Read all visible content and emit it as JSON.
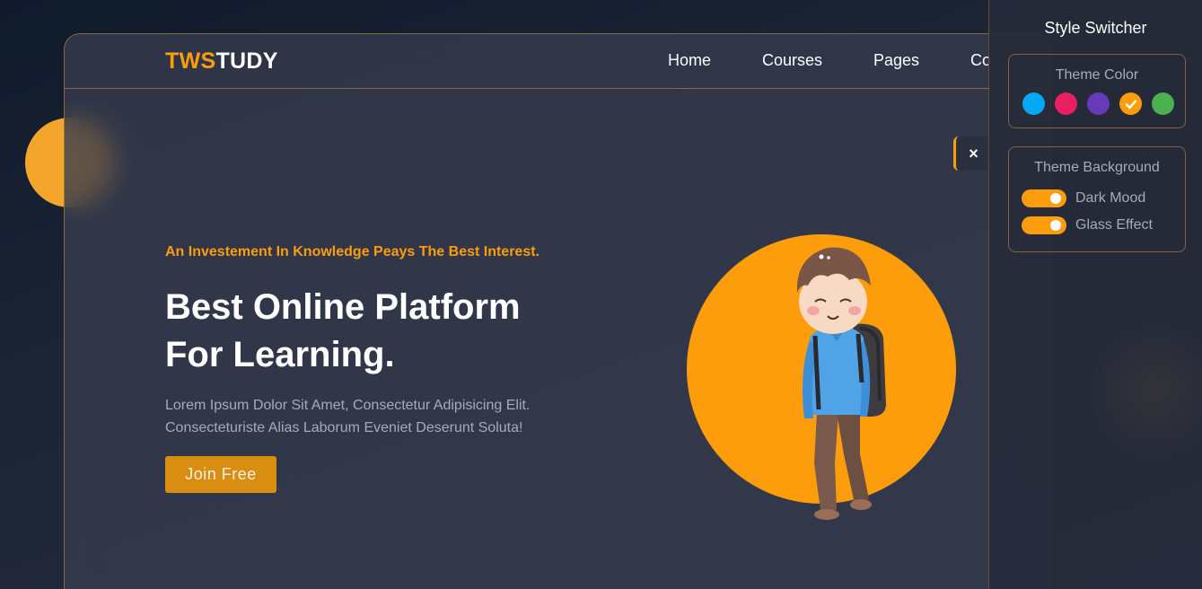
{
  "brand": {
    "part1": "TWS",
    "part2": "TUDY"
  },
  "nav": {
    "items": [
      "Home",
      "Courses",
      "Pages",
      "Co"
    ]
  },
  "hero": {
    "tagline": "An Investement In Knowledge Peays The Best Interest.",
    "heading_line1": "Best Online Platform",
    "heading_line2": "For Learning.",
    "desc_line1": "Lorem Ipsum Dolor Sit Amet, Consectetur Adipisicing Elit.",
    "desc_line2": "Consecteturiste Alias Laborum Eveniet Deserunt Soluta!",
    "cta": "Join Free"
  },
  "close_button": {
    "icon": "close-icon",
    "label": "×"
  },
  "style_switcher": {
    "title": "Style Switcher",
    "theme_color": {
      "title": "Theme Color",
      "colors": [
        "#03a9f4",
        "#e91e63",
        "#673ab7",
        "#fd9d0c",
        "#4caf50"
      ],
      "selected_index": 3,
      "selected_icon": "check-icon"
    },
    "theme_background": {
      "title": "Theme Background",
      "toggles": [
        {
          "label": "Dark Mood",
          "on": true
        },
        {
          "label": "Glass Effect",
          "on": true
        }
      ]
    }
  },
  "colors": {
    "accent": "#fd9d0c",
    "text": "#ffffff",
    "muted": "#a7abb8"
  }
}
